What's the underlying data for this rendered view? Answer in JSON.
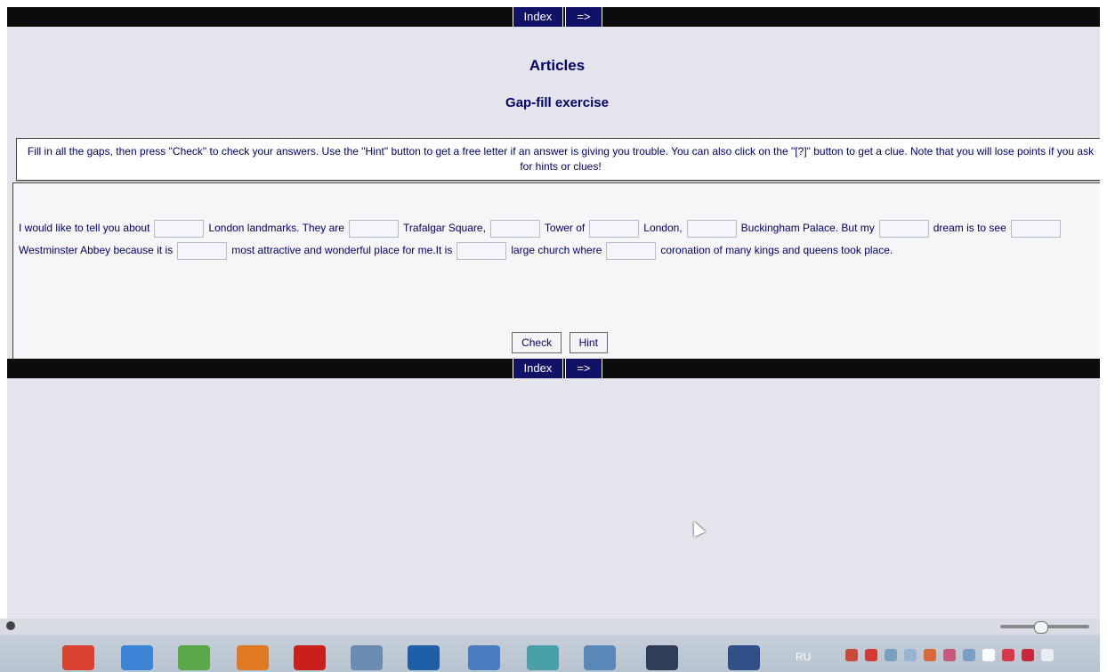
{
  "nav": {
    "index_label": "Index",
    "next_label": "=>"
  },
  "page": {
    "title": "Articles",
    "subtitle": "Gap-fill exercise"
  },
  "instructions": "Fill in all the gaps, then press \"Check\" to check your answers. Use the \"Hint\" button to get a free letter if an answer is giving you trouble. You can also click on the \"[?]\" button to get a clue. Note that you will lose points if you ask for hints or clues!",
  "passage": {
    "t1": "I would like to tell you about",
    "t2": "London landmarks. They are",
    "t3": "Trafalgar Square,",
    "t4": "Tower of",
    "t5": "London,",
    "t6": "Buckingham Palace. But my",
    "t7": "dream is to see",
    "t8": "Westminster Abbey because it is",
    "t9": "most attractive and wonderful place for me.It is",
    "t10": "large church where",
    "t11": "coronation of many kings and queens took place."
  },
  "buttons": {
    "check": "Check",
    "hint": "Hint"
  },
  "taskbar": {
    "language": "RU"
  },
  "colors": {
    "text": "#000066",
    "nav_bg": "#0c0c0c",
    "nav_button": "#111166",
    "screen_bg": "#e4e5ec"
  }
}
